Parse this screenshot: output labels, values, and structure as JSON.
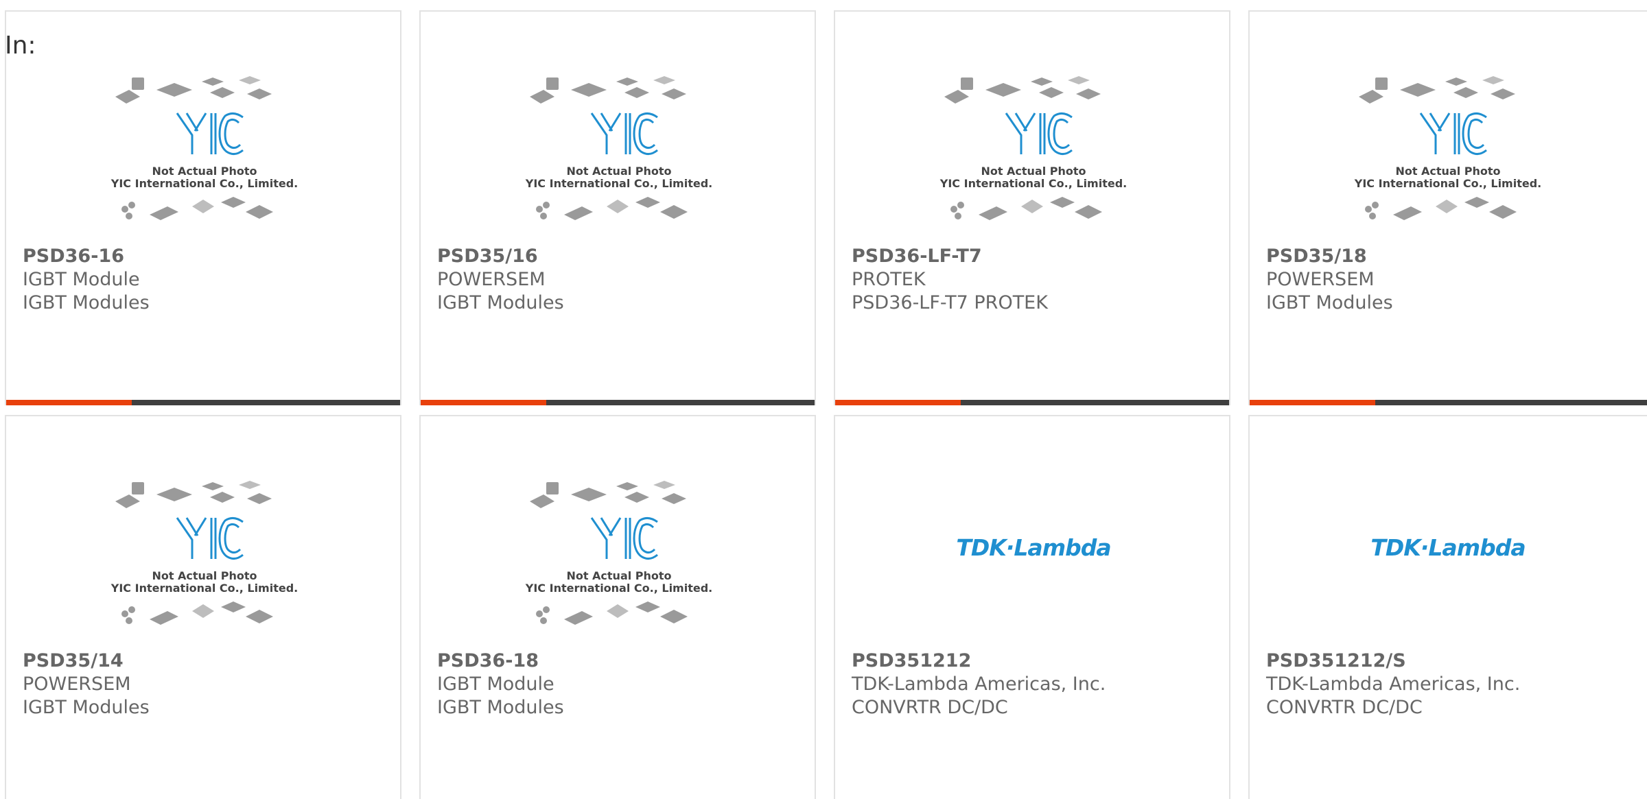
{
  "filter_label": "In:",
  "placeholder_text": {
    "line1": "Not Actual Photo",
    "line2": "YIC International Co., Limited."
  },
  "logo_text": "TDK·Lambda",
  "colors": {
    "accent": "#e8400c",
    "bar": "#3f3f3f",
    "logo_blue": "#1f8fd0"
  },
  "products": [
    {
      "part": "PSD36-16",
      "manufacturer": "IGBT Module",
      "description": "IGBT Modules",
      "image": "yic-placeholder"
    },
    {
      "part": "PSD35/16",
      "manufacturer": "POWERSEM",
      "description": "IGBT Modules",
      "image": "yic-placeholder"
    },
    {
      "part": "PSD36-LF-T7",
      "manufacturer": "PROTEK",
      "description": "PSD36-LF-T7 PROTEK",
      "image": "yic-placeholder"
    },
    {
      "part": "PSD35/18",
      "manufacturer": "POWERSEM",
      "description": "IGBT Modules",
      "image": "yic-placeholder"
    },
    {
      "part": "PSD35/14",
      "manufacturer": "POWERSEM",
      "description": "IGBT Modules",
      "image": "yic-placeholder"
    },
    {
      "part": "PSD36-18",
      "manufacturer": "IGBT Module",
      "description": "IGBT Modules",
      "image": "yic-placeholder"
    },
    {
      "part": "PSD351212",
      "manufacturer": "TDK-Lambda Americas, Inc.",
      "description": "CONVRTR DC/DC",
      "image": "tdk-lambda-logo"
    },
    {
      "part": "PSD351212/S",
      "manufacturer": "TDK-Lambda Americas, Inc.",
      "description": "CONVRTR DC/DC",
      "image": "tdk-lambda-logo"
    }
  ]
}
